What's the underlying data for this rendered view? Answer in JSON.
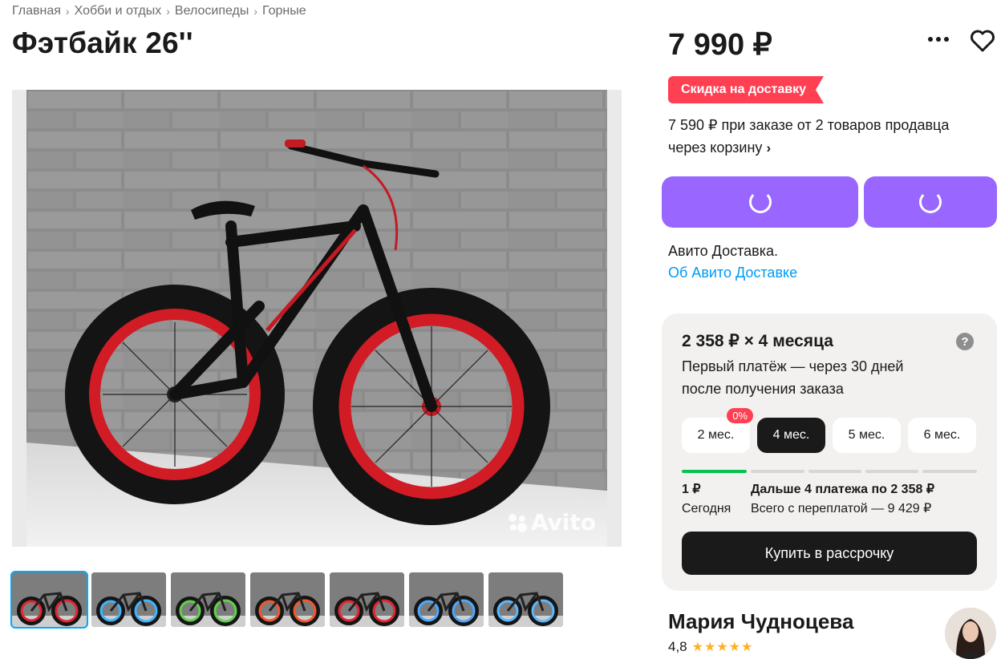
{
  "breadcrumbs": [
    "Главная",
    "Хобби и отдых",
    "Велосипеды",
    "Горные"
  ],
  "breadcrumb_separator": "›",
  "title": "Фэтбайк 26''",
  "gallery": {
    "watermark": "Avito",
    "thumbnail_rim_colors": [
      "#e0262f",
      "#3fb3ff",
      "#5fd14a",
      "#f0582c",
      "#e0262f",
      "#4aa8ff",
      "#59b8ff"
    ],
    "active_index": 0
  },
  "price": "7 990 ₽",
  "actions": {
    "more_icon": "more-horizontal-icon",
    "favorite_icon": "heart-icon"
  },
  "discount_badge": "Скидка на доставку",
  "promo": {
    "line1": "7 590 ₽ при заказе от 2 товаров продавца",
    "line2": "через корзину",
    "chevron": "›"
  },
  "delivery": {
    "text": "Авито Доставка.",
    "link": "Об Авито Доставке"
  },
  "installment": {
    "headline": "2 358 ₽ × 4 месяца",
    "help": "?",
    "subtitle_1": "Первый платёж — через 30 дней",
    "subtitle_2": "после получения заказа",
    "terms": [
      {
        "label": "2 мес.",
        "badge": "0%"
      },
      {
        "label": "4 мес.",
        "active": true
      },
      {
        "label": "5 мес."
      },
      {
        "label": "6 мес."
      }
    ],
    "progress_done_fraction": 0.2,
    "first_amount": "1 ₽",
    "first_when": "Сегодня",
    "rest_title": "Дальше 4 платежа по 2 358 ₽",
    "rest_total": "Всего с переплатой — 9 429 ₽",
    "buy_button": "Купить в рассрочку"
  },
  "seller": {
    "name": "Мария Чудноцева",
    "rating": "4,8",
    "stars": "★★★★★"
  },
  "colors": {
    "accent_purple": "#9966ff",
    "badge_red": "#ff4053",
    "link_blue": "#0099f7",
    "progress_green": "#04c44e"
  }
}
